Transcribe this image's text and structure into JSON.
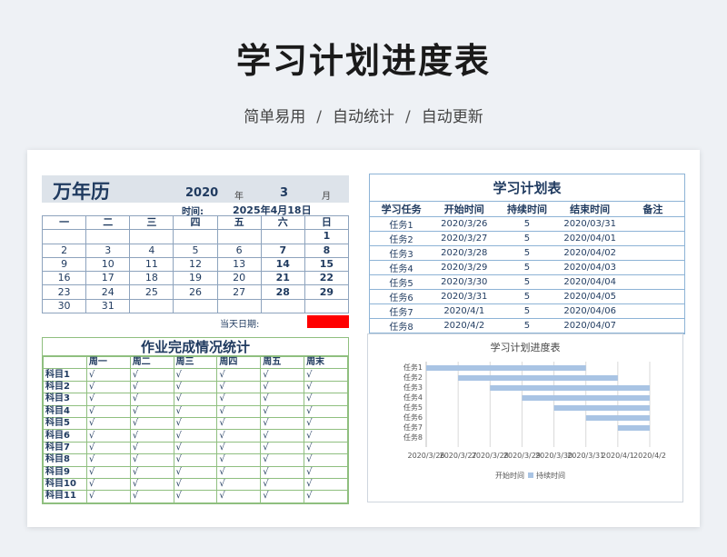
{
  "header": {
    "title": "学习计划进度表",
    "subtitle": [
      "简单易用",
      "自动统计",
      "自动更新"
    ],
    "separator": "/"
  },
  "calendar": {
    "title": "万年历",
    "year": "2020",
    "year_label": "年",
    "month": "3",
    "month_label": "月",
    "time_label": "时间:",
    "time_value": "2025年4月18日",
    "weekdays": [
      "一",
      "二",
      "三",
      "四",
      "五",
      "六",
      "日"
    ],
    "weeks": [
      [
        "",
        "",
        "",
        "",
        "",
        "",
        "1"
      ],
      [
        "2",
        "3",
        "4",
        "5",
        "6",
        "7",
        "8"
      ],
      [
        "9",
        "10",
        "11",
        "12",
        "13",
        "14",
        "15"
      ],
      [
        "16",
        "17",
        "18",
        "19",
        "20",
        "21",
        "22"
      ],
      [
        "23",
        "24",
        "25",
        "26",
        "27",
        "28",
        "29"
      ],
      [
        "30",
        "31",
        "",
        "",
        "",
        "",
        ""
      ]
    ],
    "today_label": "当天日期:",
    "today_color": "#ff0000"
  },
  "plan": {
    "title": "学习计划表",
    "columns": [
      "学习任务",
      "开始时间",
      "持续时间",
      "结束时间",
      "备注"
    ],
    "rows": [
      [
        "任务1",
        "2020/3/26",
        "5",
        "2020/03/31",
        ""
      ],
      [
        "任务2",
        "2020/3/27",
        "5",
        "2020/04/01",
        ""
      ],
      [
        "任务3",
        "2020/3/28",
        "5",
        "2020/04/02",
        ""
      ],
      [
        "任务4",
        "2020/3/29",
        "5",
        "2020/04/03",
        ""
      ],
      [
        "任务5",
        "2020/3/30",
        "5",
        "2020/04/04",
        ""
      ],
      [
        "任务6",
        "2020/3/31",
        "5",
        "2020/04/05",
        ""
      ],
      [
        "任务7",
        "2020/4/1",
        "5",
        "2020/04/06",
        ""
      ],
      [
        "任务8",
        "2020/4/2",
        "5",
        "2020/04/07",
        ""
      ]
    ]
  },
  "homework": {
    "title": "作业完成情况统计",
    "columns": [
      "",
      "周一",
      "周二",
      "周三",
      "周四",
      "周五",
      "周末"
    ],
    "subjects": [
      "科目1",
      "科目2",
      "科目3",
      "科目4",
      "科目5",
      "科目6",
      "科目7",
      "科目8",
      "科目9",
      "科目10",
      "科目11"
    ],
    "mark": "√"
  },
  "chart_data": {
    "type": "bar",
    "orientation": "horizontal",
    "stacked": true,
    "title": "学习计划进度表",
    "categories": [
      "任务1",
      "任务2",
      "任务3",
      "任务4",
      "任务5",
      "任务6",
      "任务7",
      "任务8"
    ],
    "x_ticks": [
      "2020/3/26",
      "2020/3/27",
      "2020/3/28",
      "2020/3/29",
      "2020/3/30",
      "2020/3/31",
      "2020/4/1",
      "2020/4/2"
    ],
    "series": [
      {
        "name": "开始时间",
        "values": [
          "2020/3/26",
          "2020/3/27",
          "2020/3/28",
          "2020/3/29",
          "2020/3/30",
          "2020/3/31",
          "2020/4/1",
          "2020/4/2"
        ],
        "color": "none"
      },
      {
        "name": "持续时间",
        "values": [
          5,
          5,
          5,
          5,
          5,
          5,
          5,
          5
        ],
        "color": "#a9c4e4"
      }
    ],
    "xlim": [
      "2020/3/26",
      "2020/4/2"
    ],
    "legend": "bottom",
    "grid": true
  }
}
